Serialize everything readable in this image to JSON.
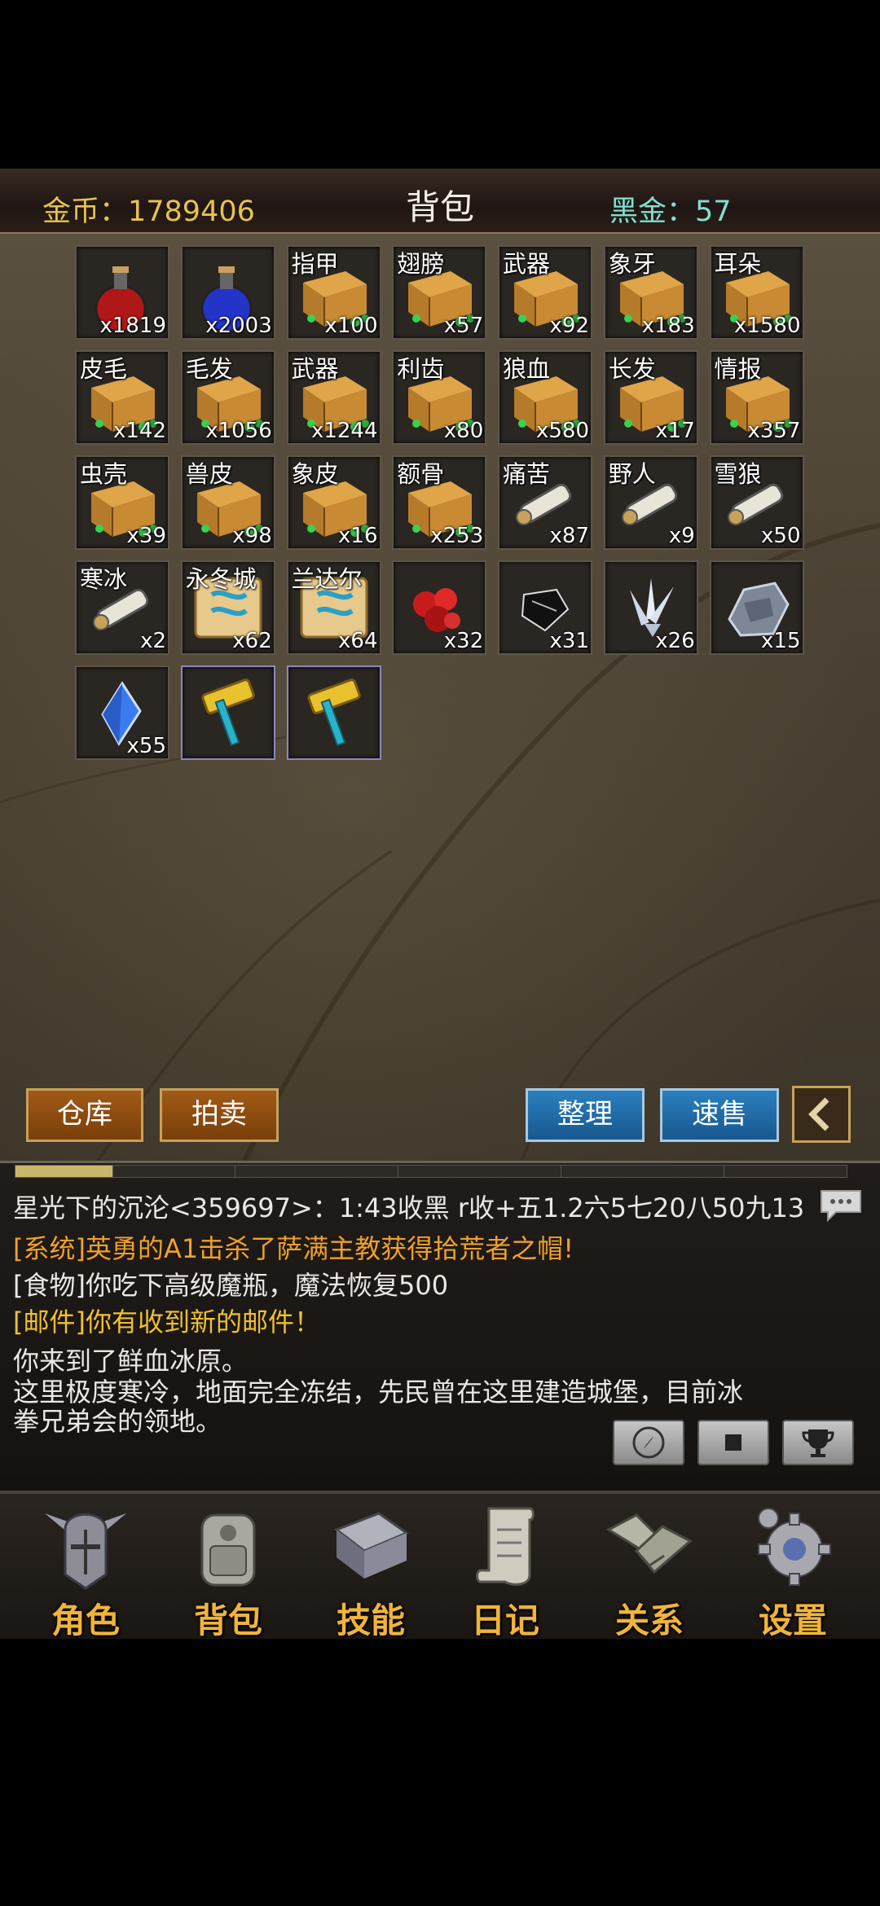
{
  "header": {
    "gold_label": "金币：1789406",
    "title": "背包",
    "black_gold_label": "黑金：57"
  },
  "inventory": {
    "slots": [
      {
        "label": "",
        "count": "x1819",
        "icon": "red-potion-icon"
      },
      {
        "label": "",
        "count": "x2003",
        "icon": "blue-potion-icon"
      },
      {
        "label": "指甲",
        "count": "x100",
        "icon": "crate-icon"
      },
      {
        "label": "翅膀",
        "count": "x57",
        "icon": "crate-icon"
      },
      {
        "label": "武器",
        "count": "x92",
        "icon": "crate-icon"
      },
      {
        "label": "象牙",
        "count": "x183",
        "icon": "crate-icon"
      },
      {
        "label": "耳朵",
        "count": "x1580",
        "icon": "crate-icon"
      },
      {
        "label": "皮毛",
        "count": "x142",
        "icon": "crate-icon"
      },
      {
        "label": "毛发",
        "count": "x1056",
        "icon": "crate-icon"
      },
      {
        "label": "武器",
        "count": "x1244",
        "icon": "crate-icon"
      },
      {
        "label": "利齿",
        "count": "x80",
        "icon": "crate-icon"
      },
      {
        "label": "狼血",
        "count": "x580",
        "icon": "crate-icon"
      },
      {
        "label": "长发",
        "count": "x17",
        "icon": "crate-icon"
      },
      {
        "label": "情报",
        "count": "x357",
        "icon": "crate-icon"
      },
      {
        "label": "虫壳",
        "count": "x39",
        "icon": "crate-icon"
      },
      {
        "label": "兽皮",
        "count": "x98",
        "icon": "crate-icon"
      },
      {
        "label": "象皮",
        "count": "x16",
        "icon": "crate-icon"
      },
      {
        "label": "额骨",
        "count": "x253",
        "icon": "crate-icon"
      },
      {
        "label": "痛苦",
        "count": "x87",
        "icon": "scroll-icon"
      },
      {
        "label": "野人",
        "count": "x9",
        "icon": "scroll-icon"
      },
      {
        "label": "雪狼",
        "count": "x50",
        "icon": "scroll-icon"
      },
      {
        "label": "寒冰",
        "count": "x2",
        "icon": "scroll-icon"
      },
      {
        "label": "永冬城",
        "count": "x62",
        "icon": "map-scroll-icon"
      },
      {
        "label": "兰达尔",
        "count": "x64",
        "icon": "map-scroll-icon"
      },
      {
        "label": "",
        "count": "x32",
        "icon": "red-ore-icon"
      },
      {
        "label": "",
        "count": "x31",
        "icon": "black-gem-icon"
      },
      {
        "label": "",
        "count": "x26",
        "icon": "white-crystal-icon"
      },
      {
        "label": "",
        "count": "x15",
        "icon": "iron-ore-icon"
      },
      {
        "label": "",
        "count": "x55",
        "icon": "blue-crystal-icon"
      },
      {
        "label": "",
        "count": "",
        "icon": "golden-hammer-icon"
      },
      {
        "label": "",
        "count": "",
        "icon": "golden-hammer-icon"
      }
    ]
  },
  "buttons": {
    "warehouse": "仓库",
    "auction": "拍卖",
    "sort": "整理",
    "quick_sell": "速售"
  },
  "chat": {
    "lines": [
      "星光下的沉沦<359697>：1:43收黑 r收+五1.2六5七20八50九13",
      "[系统]英勇的A1击杀了萨满主教获得拾荒者之帽!",
      "[食物]你吃下高级魔瓶，魔法恢复500",
      "[邮件]你有收到新的邮件！",
      "你来到了鲜血冰原。",
      "这里极度寒冷，地面完全冻结，先民曾在这里建造城堡，目前冰",
      "拳兄弟会的领地。"
    ]
  },
  "nav": {
    "items": [
      "角色",
      "背包",
      "技能",
      "日记",
      "关系",
      "设置"
    ]
  },
  "colors": {
    "gold_text": "#e8c34b",
    "black_gold_text": "#7fe0d0",
    "system_text": "#f0a02a",
    "nav_text": "#f0b43a"
  }
}
